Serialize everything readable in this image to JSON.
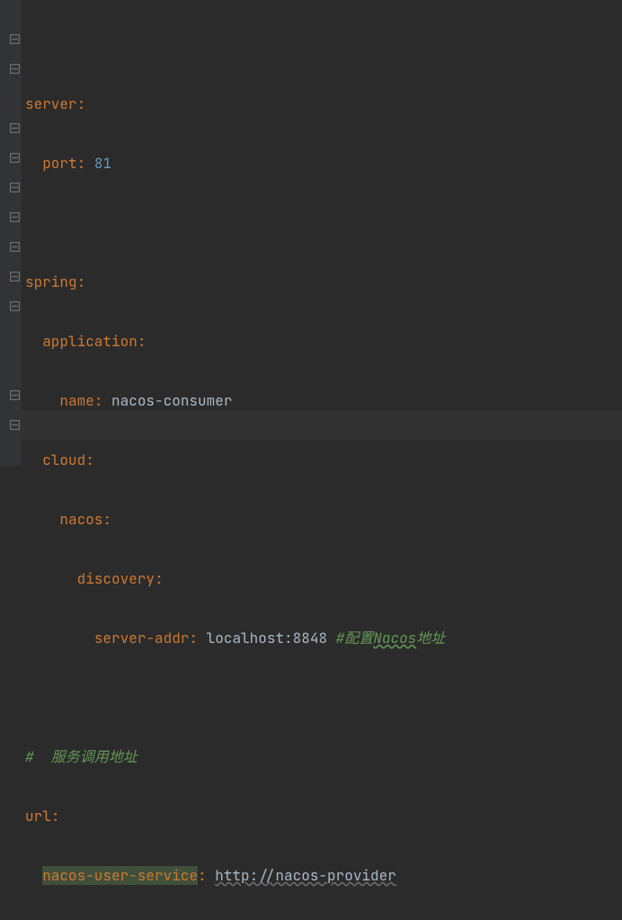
{
  "lines": {
    "l1_key": "server",
    "l2_key": "port",
    "l2_val": "81",
    "l4_key": "spring",
    "l5_key": "application",
    "l6_key": "name",
    "l6_val": "nacos-consumer",
    "l7_key": "cloud",
    "l8_key": "nacos",
    "l9_key": "discovery",
    "l10_key": "server-addr",
    "l10_val": "localhost:8848",
    "l10_comment_pre": "#配置",
    "l10_comment_wavy": "Nacos",
    "l10_comment_post": "地址",
    "l12_comment": "#  服务调用地址",
    "l13_key": "url",
    "l14_key": "nacos-user-service",
    "l14_val": "http://nacos-provider"
  }
}
